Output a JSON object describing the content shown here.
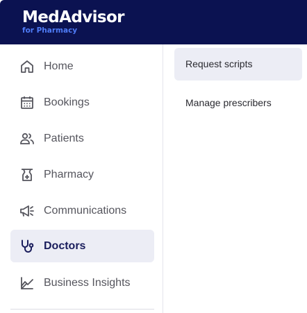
{
  "header": {
    "brand": "MedAdvisor",
    "brand_sub": "for Pharmacy"
  },
  "sidebar": {
    "items": [
      {
        "label": "Home",
        "icon": "home-icon"
      },
      {
        "label": "Bookings",
        "icon": "calendar-icon"
      },
      {
        "label": "Patients",
        "icon": "users-icon"
      },
      {
        "label": "Pharmacy",
        "icon": "pharmacy-icon"
      },
      {
        "label": "Communications",
        "icon": "megaphone-icon"
      },
      {
        "label": "Doctors",
        "icon": "stethoscope-icon",
        "active": true
      },
      {
        "label": "Business Insights",
        "icon": "chart-icon"
      }
    ]
  },
  "subnav": {
    "items": [
      {
        "label": "Request scripts",
        "active": true
      },
      {
        "label": "Manage prescribers"
      }
    ]
  },
  "colors": {
    "header_bg": "#0b1251",
    "brand_accent": "#4f7cf7",
    "active_bg": "#ecedf5",
    "active_text": "#1a1d5c"
  }
}
